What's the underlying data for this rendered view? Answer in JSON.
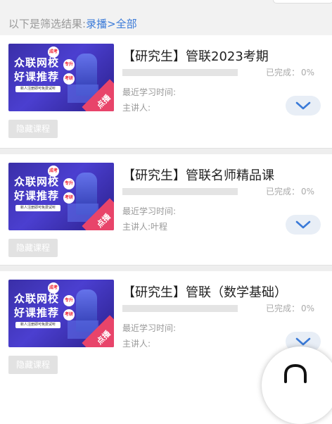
{
  "filter": {
    "prefix": "以下是筛选结果:",
    "crumb": "录播>全部"
  },
  "thumbnail": {
    "line1": "众联网校",
    "line2": "好课推荐",
    "badges": [
      "成考",
      "专升",
      "考研"
    ],
    "sub": "新人注册即可免费试听",
    "tag": "点播"
  },
  "labels": {
    "progress": "已完成：",
    "recent": "最近学习时间:",
    "lecturer": "主讲人:",
    "hide": "隐藏课程"
  },
  "courses": [
    {
      "title": "【研究生】管联2023考期",
      "progress": "0%",
      "recent_time": "",
      "lecturer": ""
    },
    {
      "title": "【研究生】管联名师精品课",
      "progress": "0%",
      "recent_time": "",
      "lecturer": "叶程"
    },
    {
      "title": "【研究生】管联（数学基础）",
      "progress": "0%",
      "recent_time": "",
      "lecturer": ""
    }
  ],
  "icons": {
    "expand": "chevron-down-icon",
    "fab": "headset-icon"
  },
  "colors": {
    "accent": "#3a7ad8",
    "hide_button": "#e2e2e2",
    "tag": "#e8446a"
  }
}
